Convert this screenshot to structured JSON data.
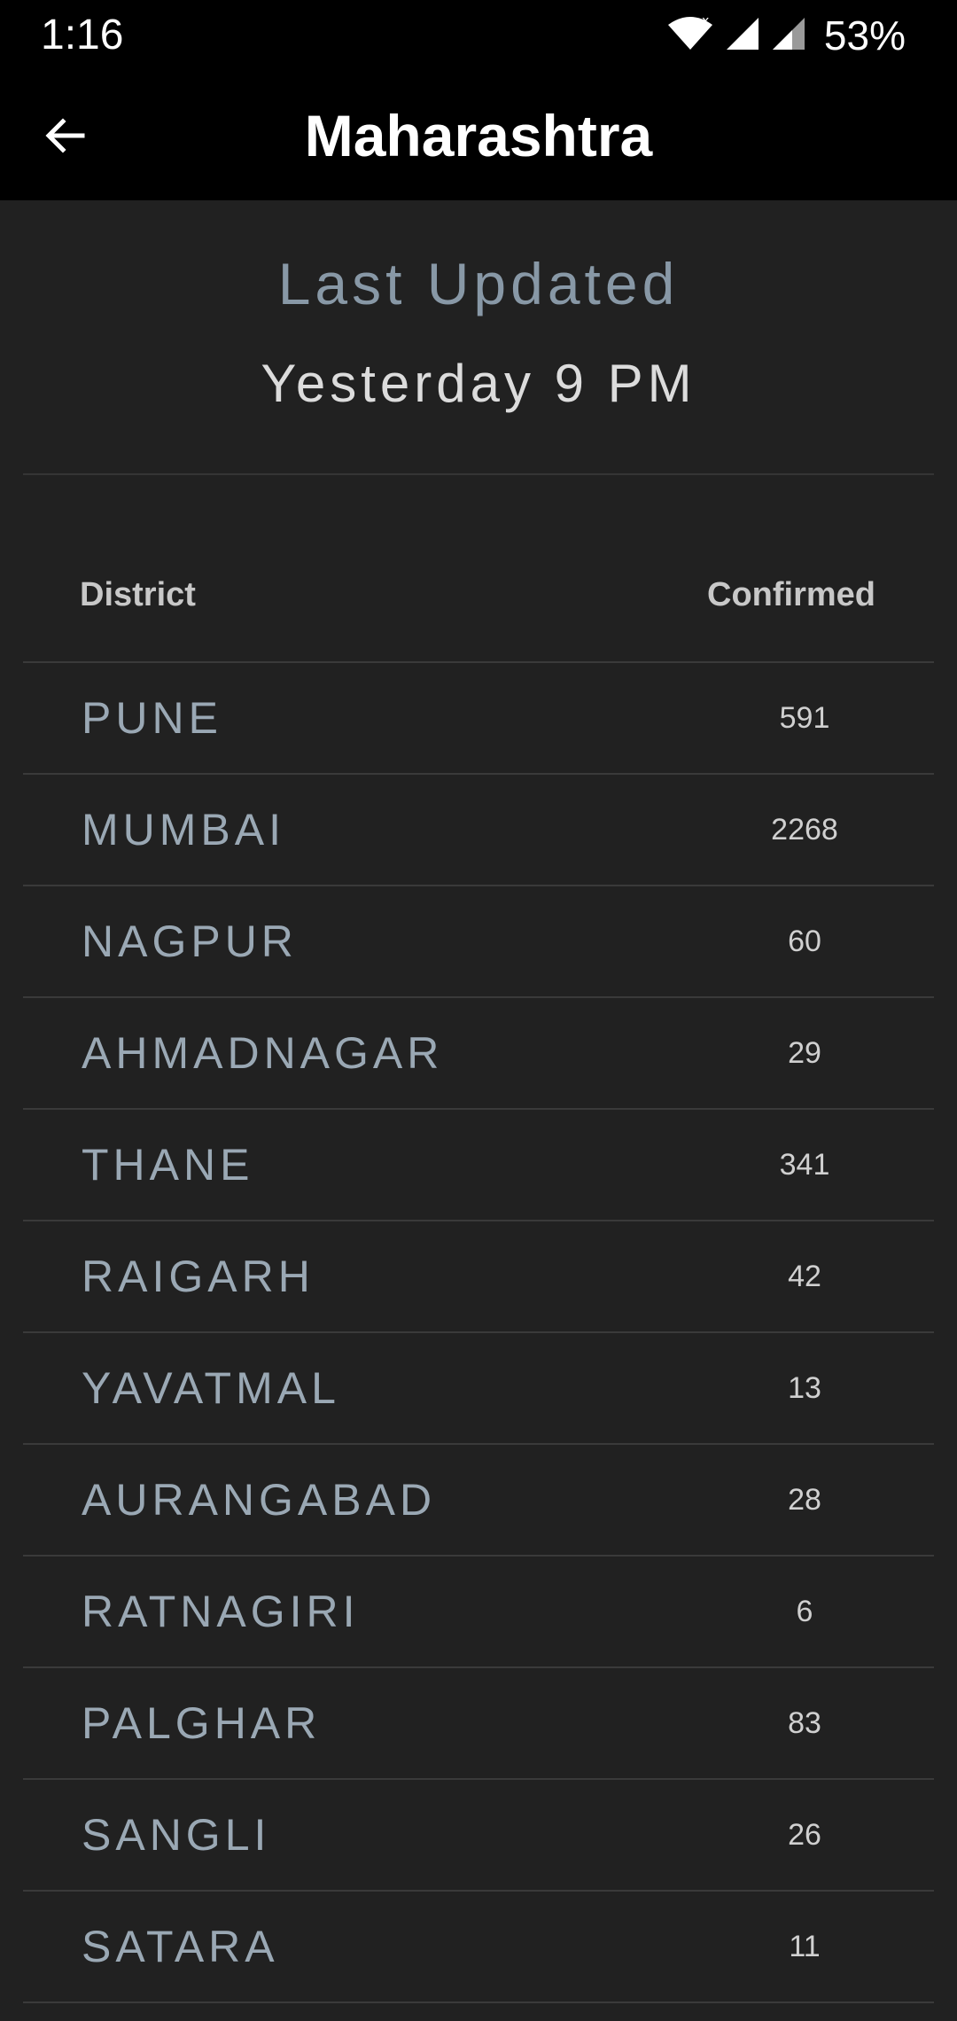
{
  "status_bar": {
    "time": "1:16",
    "battery": "53%",
    "icons": [
      "wifi-icon",
      "cell-signal-icon",
      "cell-signal-icon",
      "battery-percent"
    ]
  },
  "app_bar": {
    "title": "Maharashtra",
    "back_icon": "arrow-left-icon"
  },
  "updated": {
    "label": "Last Updated",
    "value": "Yesterday 9 PM"
  },
  "table": {
    "headers": {
      "district": "District",
      "confirmed": "Confirmed"
    },
    "rows": [
      {
        "district": "PUNE",
        "confirmed": "591"
      },
      {
        "district": "MUMBAI",
        "confirmed": "2268"
      },
      {
        "district": "NAGPUR",
        "confirmed": "60"
      },
      {
        "district": "AHMADNAGAR",
        "confirmed": "29"
      },
      {
        "district": "THANE",
        "confirmed": "341"
      },
      {
        "district": "RAIGARH",
        "confirmed": "42"
      },
      {
        "district": "YAVATMAL",
        "confirmed": "13"
      },
      {
        "district": "AURANGABAD",
        "confirmed": "28"
      },
      {
        "district": "RATNAGIRI",
        "confirmed": "6"
      },
      {
        "district": "PALGHAR",
        "confirmed": "83"
      },
      {
        "district": "SANGLI",
        "confirmed": "26"
      },
      {
        "district": "SATARA",
        "confirmed": "11"
      }
    ]
  },
  "colors": {
    "background": "#212121",
    "bar": "#000000",
    "muted_text": "#8898a6",
    "divider": "#3a3a3a"
  }
}
